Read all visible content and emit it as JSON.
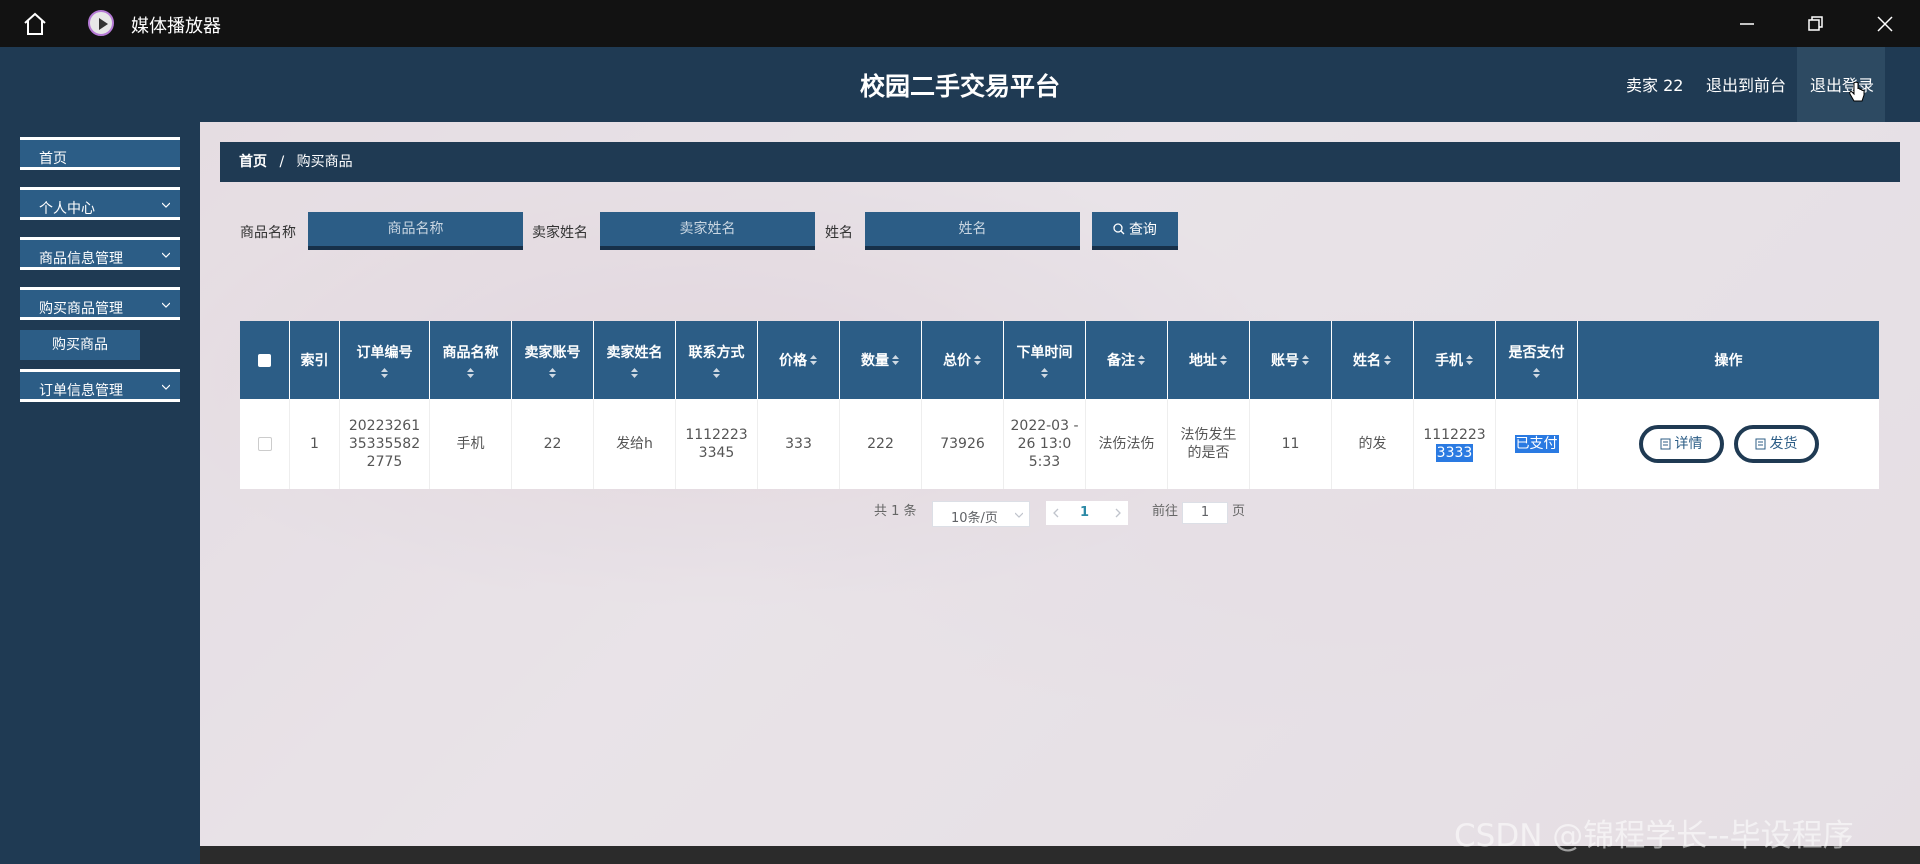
{
  "window": {
    "title": "媒体播放器"
  },
  "header": {
    "site_title": "校园二手交易平台",
    "user": "卖家 22",
    "to_front": "退出到前台",
    "logout": "退出登录"
  },
  "sidebar": {
    "items": [
      {
        "label": "首页",
        "expandable": false
      },
      {
        "label": "个人中心",
        "expandable": true
      },
      {
        "label": "商品信息管理",
        "expandable": true
      },
      {
        "label": "购买商品管理",
        "expandable": true
      },
      {
        "label": "订单信息管理",
        "expandable": true
      }
    ],
    "submenu": {
      "label": "购买商品"
    }
  },
  "breadcrumb": {
    "home": "首页",
    "sep": "/",
    "current": "购买商品"
  },
  "search": {
    "fields": [
      {
        "label": "商品名称",
        "placeholder": "商品名称"
      },
      {
        "label": "卖家姓名",
        "placeholder": "卖家姓名"
      },
      {
        "label": "姓名",
        "placeholder": "姓名"
      }
    ],
    "button": "查询"
  },
  "table": {
    "columns": [
      "索引",
      "订单编号",
      "商品名称",
      "卖家账号",
      "卖家姓名",
      "联系方式",
      "价格",
      "数量",
      "总价",
      "下单时间",
      "备注",
      "地址",
      "账号",
      "姓名",
      "手机",
      "是否支付",
      "操作"
    ],
    "rows": [
      {
        "index": "1",
        "order_no": "20223261 35335582 2775",
        "product": "手机",
        "seller_account": "22",
        "seller_name": "发给h",
        "contact": "1112223 3345",
        "price": "333",
        "quantity": "222",
        "total": "73926",
        "order_time": "2022-03 -26 13:0 5:33",
        "remark": "法伤法伤",
        "address": "法伤发生 的是否",
        "account": "11",
        "name": "的发",
        "phone_1": "1112223",
        "phone_2": "3333",
        "paid": "已支付",
        "actions": {
          "detail": "详情",
          "ship": "发货"
        }
      }
    ]
  },
  "pagination": {
    "total": "共 1 条",
    "page_size": "10条/页",
    "current": "1",
    "goto": "前往",
    "goto_value": "1",
    "page_unit": "页"
  },
  "watermark": "CSDN @锦程学长--毕设程序"
}
